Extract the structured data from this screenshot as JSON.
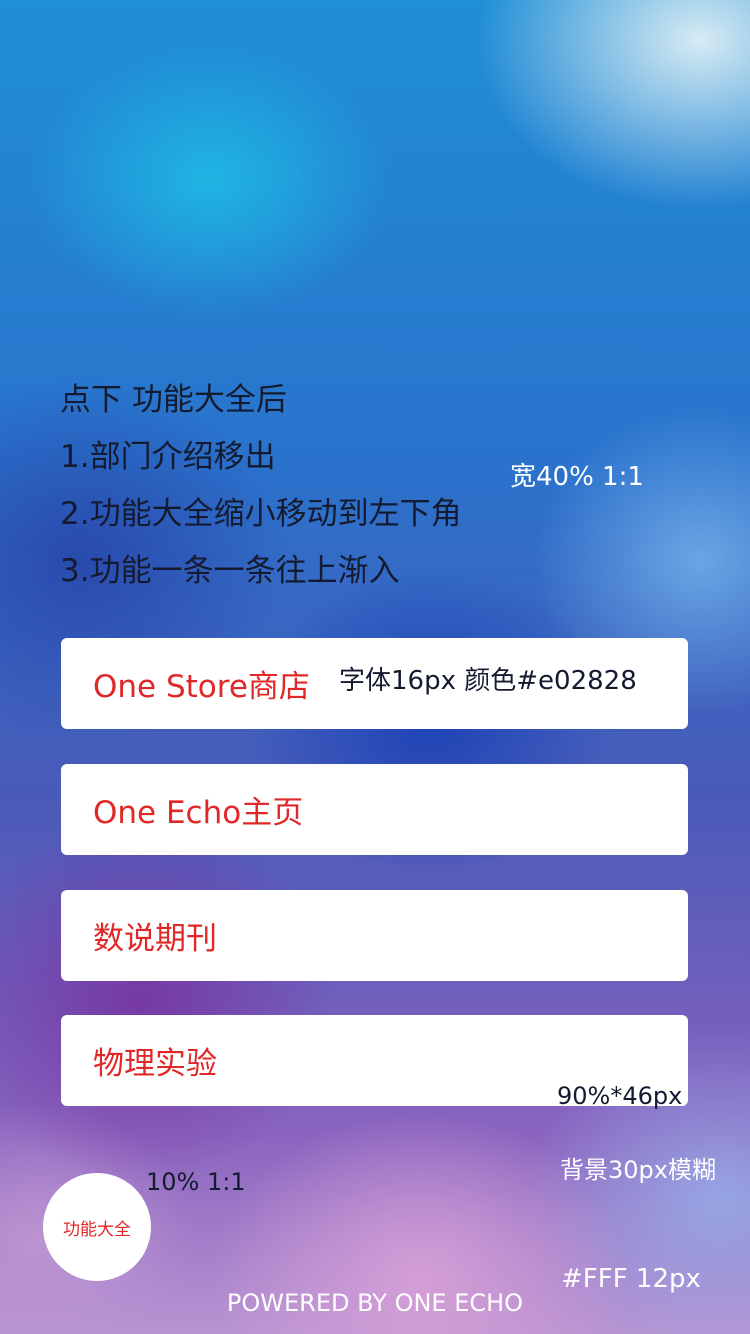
{
  "intro": {
    "lines": [
      "点下 功能大全后",
      "1.部门介绍移出",
      "2.功能大全缩小移动到左下角",
      "3.功能一条一条往上渐入"
    ]
  },
  "annotations": {
    "fab_width": "宽40% 1:1",
    "font_spec": "字体16px 颜色#e02828",
    "item_size": "90%*46px",
    "blur": "背景30px模糊",
    "fab_size": "10% 1:1",
    "footer_spec": "#FFF 12px"
  },
  "menu": {
    "items": [
      {
        "label": "One Store商店"
      },
      {
        "label": "One Echo主页"
      },
      {
        "label": "数说期刊"
      },
      {
        "label": "物理实验"
      }
    ]
  },
  "fab": {
    "label": "功能大全"
  },
  "footer": {
    "text": "POWERED BY ONE ECHO"
  },
  "colors": {
    "accent": "#e02828",
    "card": "#ffffff",
    "footer_text": "#ffffff"
  }
}
